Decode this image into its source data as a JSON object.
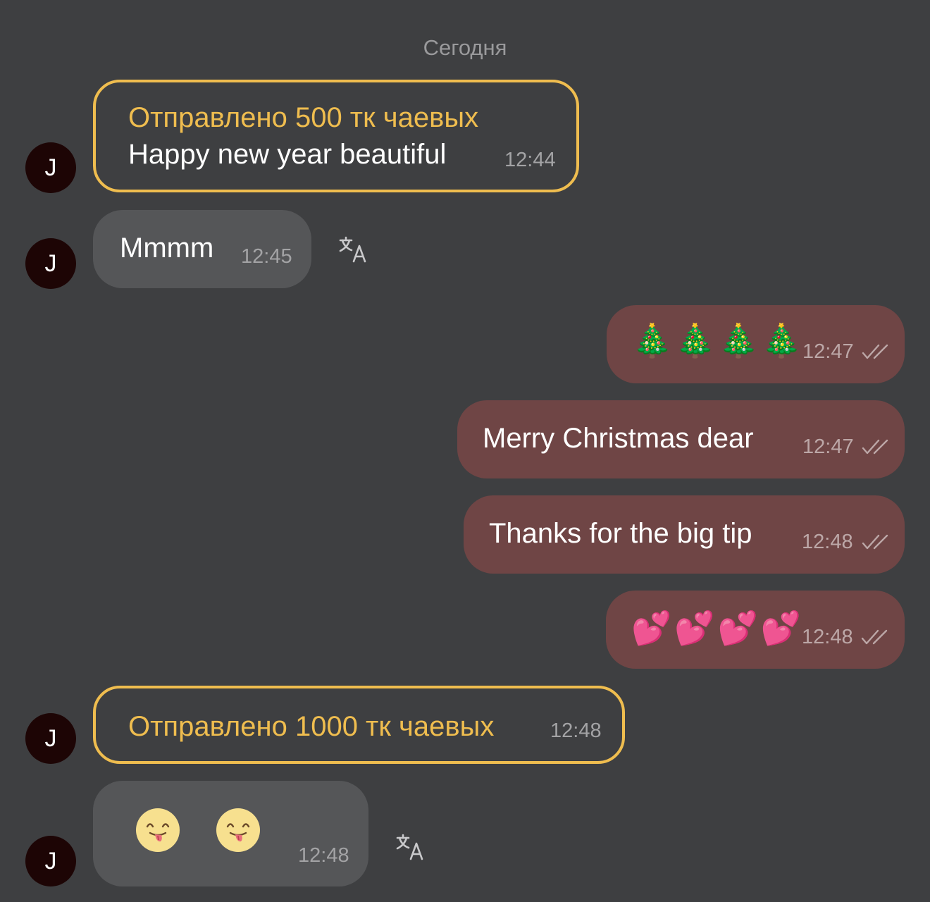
{
  "date_separator": "Сегодня",
  "avatar_letter": "J",
  "messages": {
    "tip1": {
      "title": "Отправлено 500 тк чаевых",
      "text": "Happy new year beautiful",
      "time": "12:44"
    },
    "m1": {
      "text": "Mmmm",
      "time": "12:45"
    },
    "m2": {
      "emoji": "🎄🎄🎄🎄",
      "time": "12:47",
      "status": "read"
    },
    "m3": {
      "text": "Merry Christmas dear",
      "time": "12:47",
      "status": "read"
    },
    "m4": {
      "text": "Thanks for the big tip",
      "time": "12:48",
      "status": "read"
    },
    "m5": {
      "emoji": "💕💕💕💕",
      "time": "12:48",
      "status": "read"
    },
    "tip2": {
      "title": "Отправлено 1000 тк чаевых",
      "time": "12:48"
    },
    "m6": {
      "time": "12:48"
    }
  },
  "icons": {
    "translate": "translate-icon",
    "read_ticks": "double-check-icon",
    "sticker": "yum-face-icon"
  },
  "colors": {
    "background": "#3e3f41",
    "tip_accent": "#efbd4f",
    "incoming_bubble": "#555658",
    "outgoing_bubble": "#6f4545",
    "avatar": "#1d0505"
  }
}
